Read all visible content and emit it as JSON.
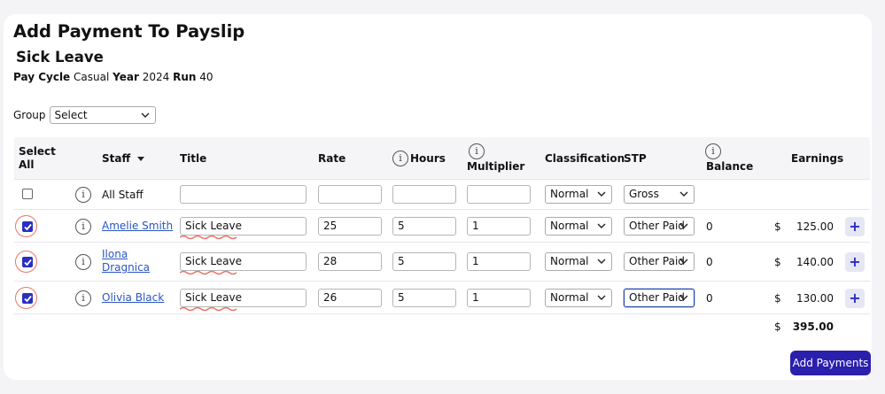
{
  "page": {
    "title": "Add Payment To Payslip",
    "subtitle": "Sick Leave",
    "meta": {
      "pay_cycle_label": "Pay Cycle",
      "pay_cycle": "Casual",
      "year_label": "Year",
      "year": "2024",
      "run_label": "Run",
      "run": "40"
    },
    "group": {
      "label": "Group",
      "value": "Select"
    }
  },
  "table": {
    "headers": {
      "select_all": [
        "Select",
        "All"
      ],
      "staff": "Staff",
      "title": "Title",
      "rate": "Rate",
      "hours": "Hours",
      "multiplier": "Multiplier",
      "classification": "Classification",
      "stp": "STP",
      "balance": "Balance",
      "earnings": "Earnings"
    },
    "all_staff_row": {
      "label": "All Staff",
      "title": "",
      "rate": "",
      "hours": "",
      "multiplier": "",
      "classification": "Normal",
      "stp": "Gross"
    },
    "rows": [
      {
        "checked": true,
        "staff": "Amelie Smith",
        "staff_lines": [
          "Amelie Smith"
        ],
        "title": "Sick Leave",
        "rate": "25",
        "hours": "5",
        "multiplier": "1",
        "classification": "Normal",
        "stp": "Other Paid",
        "balance": "0",
        "currency": "$",
        "earnings": "125.00"
      },
      {
        "checked": true,
        "staff": "Ilona Dragnica",
        "staff_lines": [
          "Ilona",
          "Dragnica"
        ],
        "title": "Sick Leave",
        "rate": "28",
        "hours": "5",
        "multiplier": "1",
        "classification": "Normal",
        "stp": "Other Paid",
        "balance": "0",
        "currency": "$",
        "earnings": "140.00"
      },
      {
        "checked": true,
        "staff": "Olivia Black",
        "staff_lines": [
          "Olivia Black"
        ],
        "title": "Sick Leave",
        "rate": "26",
        "hours": "5",
        "multiplier": "1",
        "classification": "Normal",
        "stp": "Other Paid",
        "balance": "0",
        "currency": "$",
        "earnings": "130.00"
      }
    ],
    "total": {
      "currency": "$",
      "value": "395.00"
    }
  },
  "actions": {
    "add_payments": "Add Payments",
    "add_row_symbol": "+"
  },
  "icons": {
    "info": "info-icon",
    "sort": "sort-down-icon",
    "chevron": "chevron-down-icon",
    "check": "check-icon"
  },
  "colors": {
    "accent": "#2b1fae",
    "link": "#2a56c6",
    "spellcheck": "#e9766b"
  }
}
